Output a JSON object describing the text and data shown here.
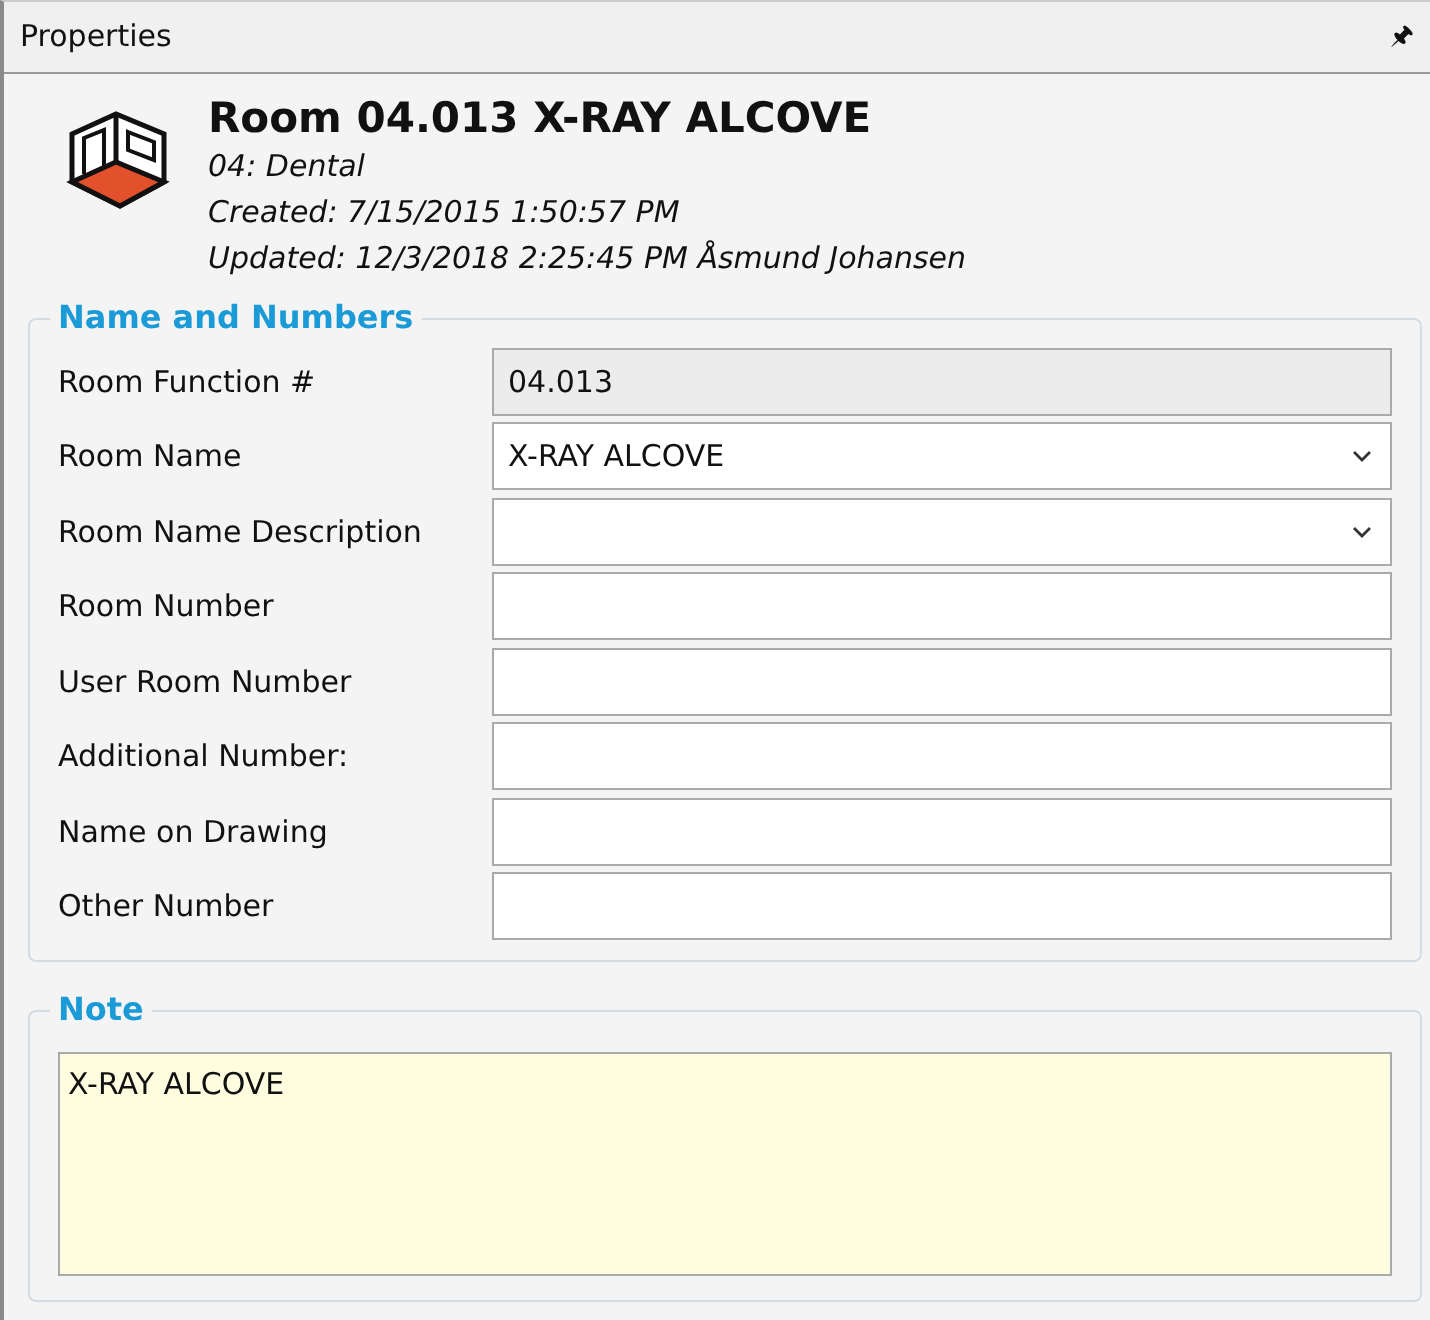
{
  "panel": {
    "title": "Properties",
    "pin": "🖈"
  },
  "header": {
    "title": "Room 04.013 X-RAY ALCOVE",
    "lines": [
      "04: Dental",
      "Created: 7/15/2015 1:50:57 PM",
      "Updated: 12/3/2018 2:25:45 PM Åsmund Johansen"
    ]
  },
  "name_and_numbers": {
    "legend": "Name and Numbers",
    "fields": [
      {
        "label": "Room Function #",
        "kind": "readonly",
        "value": "04.013"
      },
      {
        "label": "Room Name",
        "kind": "combo",
        "value": "X-RAY ALCOVE"
      },
      {
        "label": "Room Name Description",
        "kind": "combo"
      },
      {
        "label": "Room Number",
        "kind": "text"
      },
      {
        "label": "User Room Number",
        "kind": "text"
      },
      {
        "label": "Additional Number:",
        "kind": "text"
      },
      {
        "label": "Name on Drawing",
        "kind": "text"
      },
      {
        "label": "Other Number",
        "kind": "text"
      }
    ]
  },
  "note": {
    "legend": "Note",
    "value": "X-RAY ALCOVE"
  }
}
